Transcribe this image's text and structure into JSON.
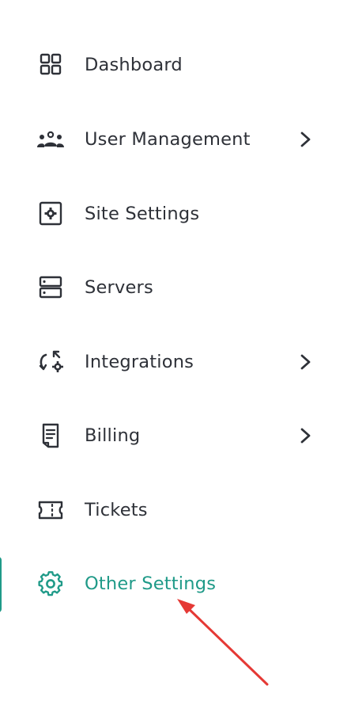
{
  "colors": {
    "text": "#2e3138",
    "accent": "#1f9a88",
    "arrow": "#e53935"
  },
  "sidebar": {
    "items": [
      {
        "label": "Dashboard",
        "icon": "dashboard-grid-icon",
        "has_submenu": false
      },
      {
        "label": "User Management",
        "icon": "users-group-icon",
        "has_submenu": true
      },
      {
        "label": "Site Settings",
        "icon": "site-settings-icon",
        "has_submenu": false
      },
      {
        "label": "Servers",
        "icon": "server-icon",
        "has_submenu": false
      },
      {
        "label": "Integrations",
        "icon": "integrations-icon",
        "has_submenu": true
      },
      {
        "label": "Billing",
        "icon": "billing-document-icon",
        "has_submenu": true
      },
      {
        "label": "Tickets",
        "icon": "ticket-icon",
        "has_submenu": false
      },
      {
        "label": "Other Settings",
        "icon": "gear-icon",
        "has_submenu": false,
        "active": true
      }
    ]
  }
}
